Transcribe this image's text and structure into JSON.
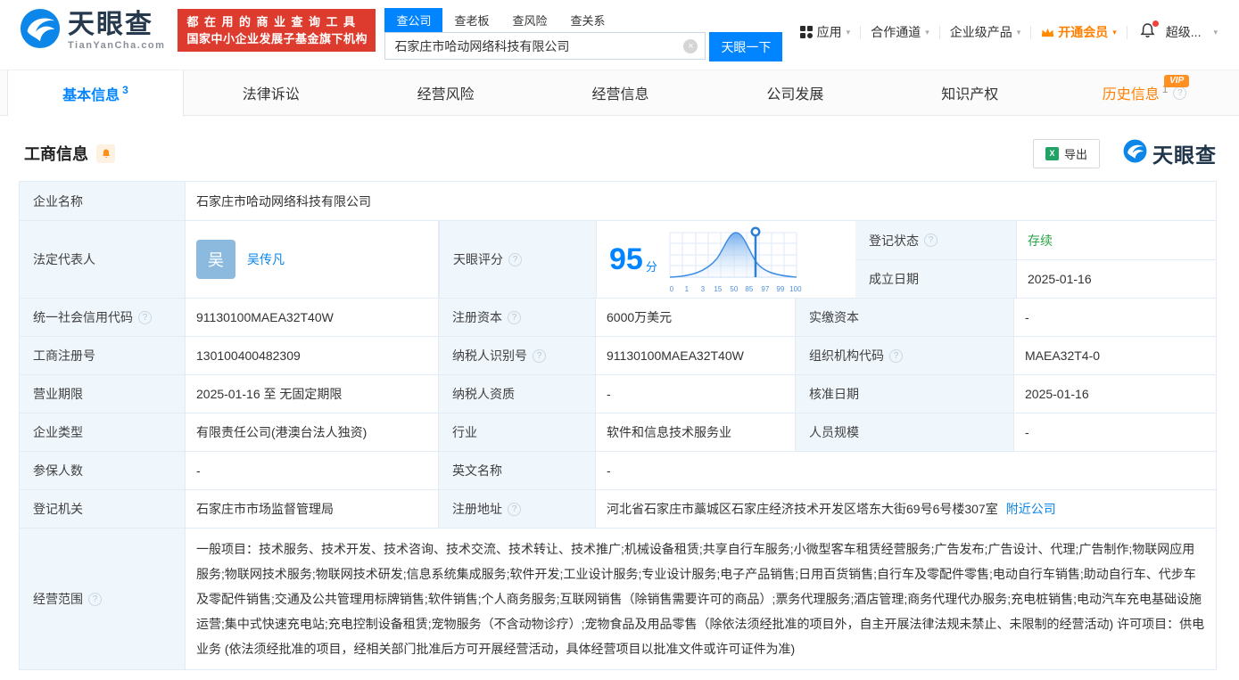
{
  "icons": {
    "help": "?",
    "caret": "▾",
    "clear": "×",
    "excel_x": "X"
  },
  "header": {
    "brand": {
      "name": "天眼查",
      "domain": "TianYanCha.com"
    },
    "slogan": {
      "line1": "都在用的商业查询工具",
      "line2": "国家中小企业发展子基金旗下机构"
    },
    "search": {
      "tabs": [
        {
          "label": "查公司"
        },
        {
          "label": "查老板"
        },
        {
          "label": "查风险"
        },
        {
          "label": "查关系"
        }
      ],
      "value": "石家庄市哈动网络科技有限公司",
      "button": "天眼一下"
    },
    "nav": [
      {
        "label": "应用"
      },
      {
        "label": "合作通道"
      },
      {
        "label": "企业级产品"
      },
      {
        "label": "开通会员"
      },
      {
        "label": "超级..."
      }
    ]
  },
  "tabs": [
    {
      "label": "基本信息",
      "count": "3"
    },
    {
      "label": "法律诉讼"
    },
    {
      "label": "经营风险"
    },
    {
      "label": "经营信息"
    },
    {
      "label": "公司发展"
    },
    {
      "label": "知识产权"
    },
    {
      "label": "历史信息",
      "count": "1",
      "badge": "VIP"
    }
  ],
  "section": {
    "title": "工商信息",
    "export_label": "导出",
    "brand": "天眼查"
  },
  "fields": {
    "company_name": {
      "label": "企业名称",
      "value": "石家庄市哈动网络科技有限公司"
    },
    "legal_rep": {
      "label": "法定代表人",
      "avatar": "吴",
      "name": "吴传凡"
    },
    "reg_status": {
      "label": "登记状态",
      "value": "存续"
    },
    "est_date": {
      "label": "成立日期",
      "value": "2025-01-16"
    },
    "score": {
      "label": "天眼评分",
      "value": "95",
      "unit": "分"
    },
    "credit_code": {
      "label": "统一社会信用代码",
      "value": "91130100MAEA32T40W"
    },
    "reg_capital": {
      "label": "注册资本",
      "value": "6000万美元"
    },
    "paid_capital": {
      "label": "实缴资本",
      "value": "-"
    },
    "reg_no": {
      "label": "工商注册号",
      "value": "130100400482309"
    },
    "taxpayer_no": {
      "label": "纳税人识别号",
      "value": "91130100MAEA32T40W"
    },
    "org_code": {
      "label": "组织机构代码",
      "value": "MAEA32T4-0"
    },
    "term": {
      "label": "营业期限",
      "value": "2025-01-16 至 无固定期限"
    },
    "taxpayer_quality": {
      "label": "纳税人资质",
      "value": "-"
    },
    "approval_date": {
      "label": "核准日期",
      "value": "2025-01-16"
    },
    "company_type": {
      "label": "企业类型",
      "value": "有限责任公司(港澳台法人独资)"
    },
    "industry": {
      "label": "行业",
      "value": "软件和信息技术服务业"
    },
    "staff_size": {
      "label": "人员规模",
      "value": "-"
    },
    "insured": {
      "label": "参保人数",
      "value": "-"
    },
    "english_name": {
      "label": "英文名称",
      "value": "-"
    },
    "authority": {
      "label": "登记机关",
      "value": "石家庄市市场监督管理局"
    },
    "address": {
      "label": "注册地址",
      "value": "河北省石家庄市藁城区石家庄经济技术开发区塔东大街69号6号楼307室",
      "link": "附近公司"
    },
    "scope": {
      "label": "经营范围",
      "value": "一般项目：技术服务、技术开发、技术咨询、技术交流、技术转让、技术推广;机械设备租赁;共享自行车服务;小微型客车租赁经营服务;广告发布;广告设计、代理;广告制作;物联网应用服务;物联网技术服务;物联网技术研发;信息系统集成服务;软件开发;工业设计服务;专业设计服务;电子产品销售;日用百货销售;自行车及零配件零售;电动自行车销售;助动自行车、代步车及零配件销售;交通及公共管理用标牌销售;软件销售;个人商务服务;互联网销售（除销售需要许可的商品）;票务代理服务;酒店管理;商务代理代办服务;充电桩销售;电动汽车充电基础设施运营;集中式快速充电站;充电控制设备租赁;宠物服务（不含动物诊疗）;宠物食品及用品零售（除依法须经批准的项目外，自主开展法律法规未禁止、未限制的经营活动) 许可项目：供电业务 (依法须经批准的项目，经相关部门批准后方可开展经营活动，具体经营项目以批准文件或许可证件为准)"
    }
  },
  "score_chart": {
    "type": "area",
    "x_ticks": [
      "0",
      "1",
      "3",
      "15",
      "50",
      "85",
      "97",
      "99",
      "100"
    ],
    "marker_score": 95,
    "curve_color": "#3f8ce5"
  },
  "colors": {
    "primary_blue": "#0084ff",
    "status_green": "#2ba245",
    "vip_orange": "#ff8a00",
    "slogan_red": "#dd3b2e"
  }
}
